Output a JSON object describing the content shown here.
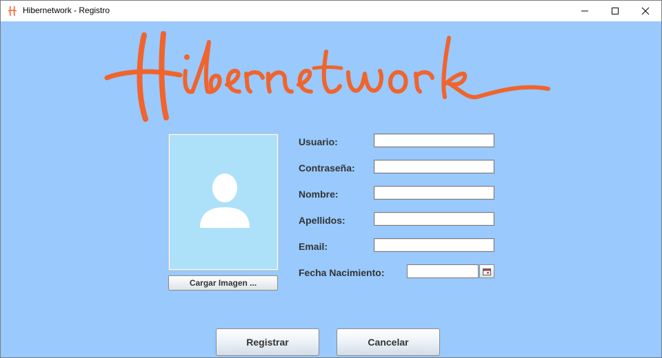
{
  "window": {
    "title": "Hibernetwork - Registro",
    "controls": [
      "minimize-icon",
      "maximize-icon",
      "close-icon"
    ]
  },
  "logo": {
    "text": "Hibernetwork",
    "color": "#f0642d"
  },
  "photo": {
    "icon": "user-icon",
    "button_label": "Cargar Imagen ..."
  },
  "form": {
    "usuario": {
      "label": "Usuario:",
      "value": ""
    },
    "contrasena": {
      "label": "Contraseña:",
      "value": ""
    },
    "nombre": {
      "label": "Nombre:",
      "value": ""
    },
    "apellidos": {
      "label": "Apellidos:",
      "value": ""
    },
    "email": {
      "label": "Email:",
      "value": ""
    },
    "fecha": {
      "label": "Fecha Nacimiento:",
      "value": "",
      "icon": "calendar-icon"
    }
  },
  "actions": {
    "register_label": "Registrar",
    "cancel_label": "Cancelar"
  },
  "colors": {
    "background": "#99c9fd",
    "photo_bg": "#ade1fa",
    "accent": "#f0642d"
  }
}
